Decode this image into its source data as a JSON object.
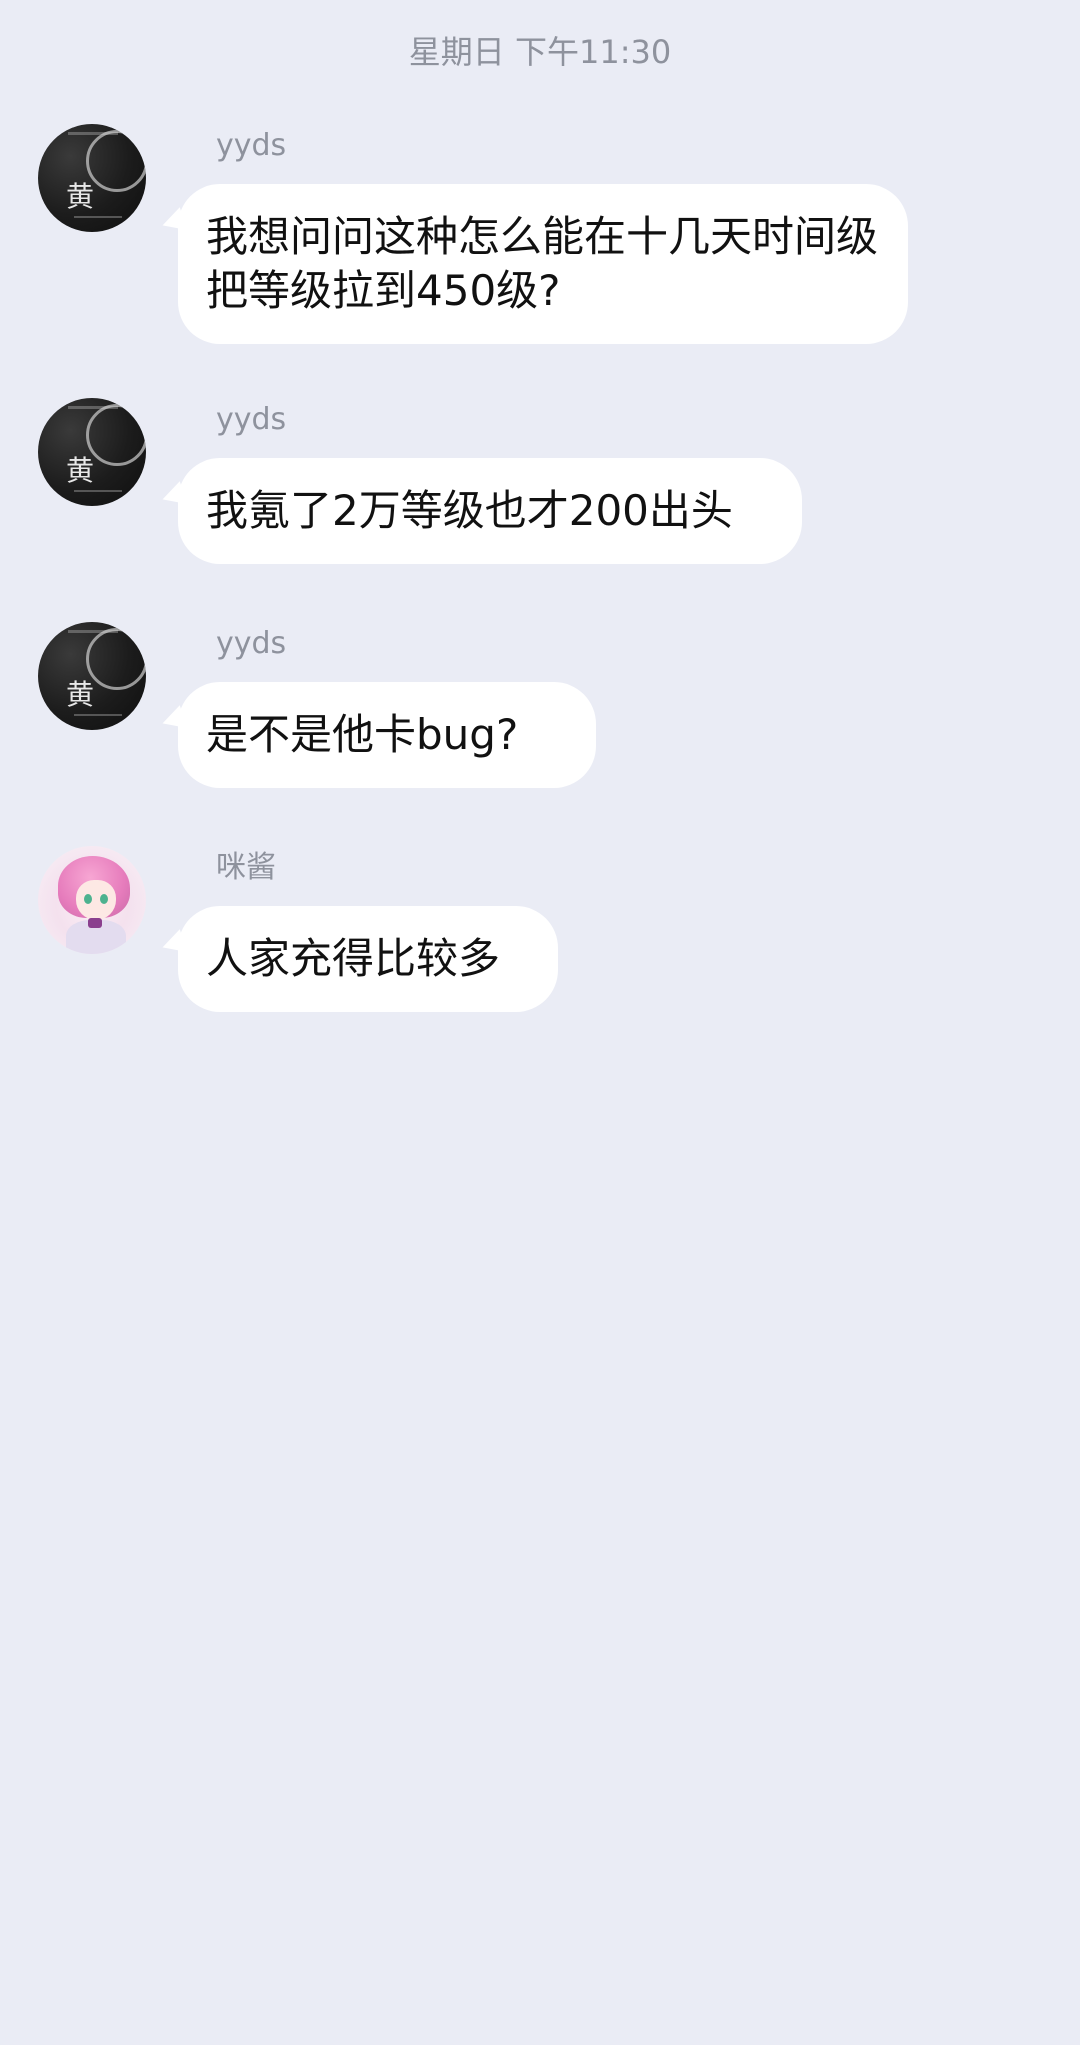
{
  "timestamp": "星期日 下午11:30",
  "messages": [
    {
      "sender": "yyds",
      "avatar_icon": "dark-portrait-avatar-icon",
      "avatar_glyph": "黄",
      "text": "我想问问这种怎么能在十几天时间级把等级拉到450级?"
    },
    {
      "sender": "yyds",
      "avatar_icon": "dark-portrait-avatar-icon",
      "avatar_glyph": "黄",
      "text": "我氪了2万等级也才200出头"
    },
    {
      "sender": "yyds",
      "avatar_icon": "dark-portrait-avatar-icon",
      "avatar_glyph": "黄",
      "text": "是不是他卡bug?"
    },
    {
      "sender": "咪酱",
      "avatar_icon": "anime-girl-avatar-icon",
      "text": "人家充得比较多"
    }
  ]
}
